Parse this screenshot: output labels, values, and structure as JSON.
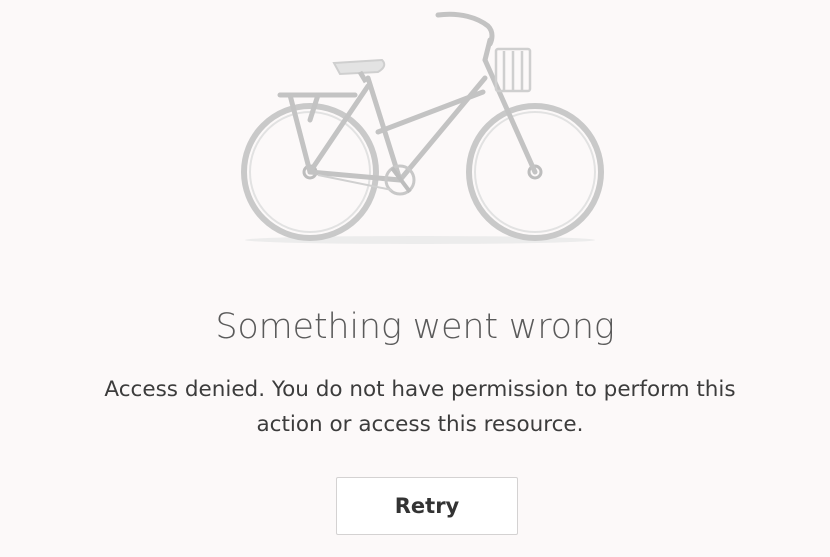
{
  "error": {
    "illustration": "bicycle-icon",
    "title": "Something went wrong",
    "message_line1": "Access denied. You do not have permission to perform this",
    "message_line2": "action or access this resource.",
    "retry_label": "Retry"
  },
  "colors": {
    "background": "#fcf9f9",
    "illustration_stroke": "#c8c8c8",
    "title_text": "#5a5a5a",
    "body_text": "#3c3c3c",
    "button_border": "#d4d2d2"
  }
}
